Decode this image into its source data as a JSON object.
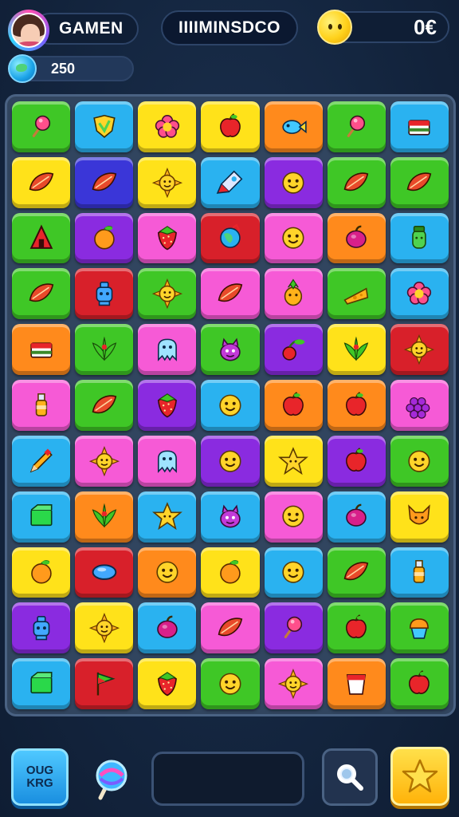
{
  "hud": {
    "player_name": "GAMEN",
    "title": "IIIIMINSDCO",
    "coins": "0€",
    "level": "250"
  },
  "bottom_bar": {
    "play_button_line1": "OUG",
    "play_button_line2": "KRG"
  },
  "palette": {
    "green": "#3fc726",
    "blue": "#2ab2f0",
    "yellow": "#ffe21a",
    "orange": "#ff8a1c",
    "purple": "#8a2be0",
    "pink": "#f65ad6",
    "red": "#d8202a",
    "darkblue": "#3a36d8"
  },
  "board": {
    "rows": [
      [
        [
          "green",
          "lollipop"
        ],
        [
          "blue",
          "shield"
        ],
        [
          "yellow",
          "flower"
        ],
        [
          "yellow",
          "apple"
        ],
        [
          "orange",
          "fish"
        ],
        [
          "green",
          "lollipop"
        ],
        [
          "blue",
          "cake"
        ]
      ],
      [
        [
          "yellow",
          "leaf"
        ],
        [
          "darkblue",
          "leaf"
        ],
        [
          "yellow",
          "sun"
        ],
        [
          "blue",
          "rocket"
        ],
        [
          "purple",
          "smiley"
        ],
        [
          "green",
          "leaf"
        ],
        [
          "green",
          "leaf"
        ]
      ],
      [
        [
          "green",
          "triangle"
        ],
        [
          "purple",
          "orange-fruit"
        ],
        [
          "pink",
          "strawberry"
        ],
        [
          "red",
          "globe"
        ],
        [
          "pink",
          "smiley"
        ],
        [
          "orange",
          "plum"
        ],
        [
          "blue",
          "jar"
        ]
      ],
      [
        [
          "green",
          "leaf"
        ],
        [
          "red",
          "robot"
        ],
        [
          "green",
          "sun"
        ],
        [
          "pink",
          "leaf"
        ],
        [
          "pink",
          "pineapple"
        ],
        [
          "green",
          "cheese"
        ],
        [
          "blue",
          "flower"
        ]
      ],
      [
        [
          "orange",
          "cake"
        ],
        [
          "green",
          "plant"
        ],
        [
          "pink",
          "ghost"
        ],
        [
          "green",
          "monster"
        ],
        [
          "purple",
          "cherry"
        ],
        [
          "yellow",
          "plant"
        ],
        [
          "red",
          "sun"
        ]
      ],
      [
        [
          "pink",
          "bottle"
        ],
        [
          "green",
          "leaf"
        ],
        [
          "purple",
          "strawberry"
        ],
        [
          "blue",
          "smiley"
        ],
        [
          "orange",
          "apple"
        ],
        [
          "orange",
          "apple"
        ],
        [
          "pink",
          "grapes"
        ]
      ],
      [
        [
          "blue",
          "pencil"
        ],
        [
          "pink",
          "sun"
        ],
        [
          "pink",
          "ghost"
        ],
        [
          "purple",
          "smiley"
        ],
        [
          "yellow",
          "star"
        ],
        [
          "purple",
          "apple"
        ],
        [
          "green",
          "smiley"
        ]
      ],
      [
        [
          "blue",
          "box"
        ],
        [
          "orange",
          "plant"
        ],
        [
          "blue",
          "star"
        ],
        [
          "blue",
          "monster"
        ],
        [
          "pink",
          "smiley"
        ],
        [
          "blue",
          "plum"
        ],
        [
          "yellow",
          "fox"
        ]
      ],
      [
        [
          "yellow",
          "orange-fruit"
        ],
        [
          "red",
          "gem"
        ],
        [
          "orange",
          "smiley"
        ],
        [
          "yellow",
          "orange-fruit"
        ],
        [
          "blue",
          "smiley"
        ],
        [
          "green",
          "leaf"
        ],
        [
          "blue",
          "bottle"
        ]
      ],
      [
        [
          "purple",
          "robot"
        ],
        [
          "yellow",
          "sun"
        ],
        [
          "blue",
          "plum"
        ],
        [
          "pink",
          "leaf"
        ],
        [
          "purple",
          "lollipop"
        ],
        [
          "green",
          "apple"
        ],
        [
          "green",
          "cupcake"
        ]
      ],
      [
        [
          "blue",
          "box"
        ],
        [
          "red",
          "flag"
        ],
        [
          "yellow",
          "strawberry"
        ],
        [
          "green",
          "smiley"
        ],
        [
          "pink",
          "sun"
        ],
        [
          "orange",
          "cup"
        ],
        [
          "green",
          "apple"
        ]
      ]
    ]
  }
}
